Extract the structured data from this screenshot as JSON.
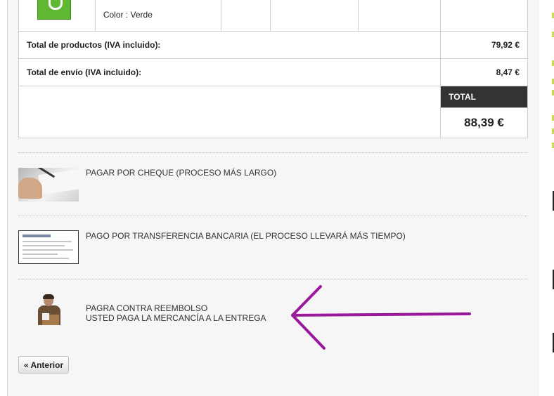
{
  "cart": {
    "product": {
      "color_text": "Color : Verde"
    },
    "rows": {
      "products_label": "Total de productos (IVA incluido):",
      "products_value": "79,92 €",
      "shipping_label": "Total de envío (IVA incluido):",
      "shipping_value": "8,47 €"
    },
    "total": {
      "header": "TOTAL",
      "value": "88,39 €"
    }
  },
  "payments": {
    "cheque": {
      "label": "PAGAR POR CHEQUE (PROCESO MÁS LARGO)"
    },
    "transfer": {
      "label": "PAGO POR TRANSFERENCIA BANCARIA (EL PROCESO LLEVARÁ MÁS TIEMPO)"
    },
    "cod": {
      "line1": "PAGRA CONTRA REEMBOLSO",
      "line2": "USTED PAGA LA MERCANCÍA A LA ENTREGA"
    }
  },
  "nav": {
    "previous_label": "« Anterior"
  },
  "colors": {
    "arrow": "#9b179b",
    "total_header_bg": "#333333",
    "product_thumb": "#5fb832"
  }
}
